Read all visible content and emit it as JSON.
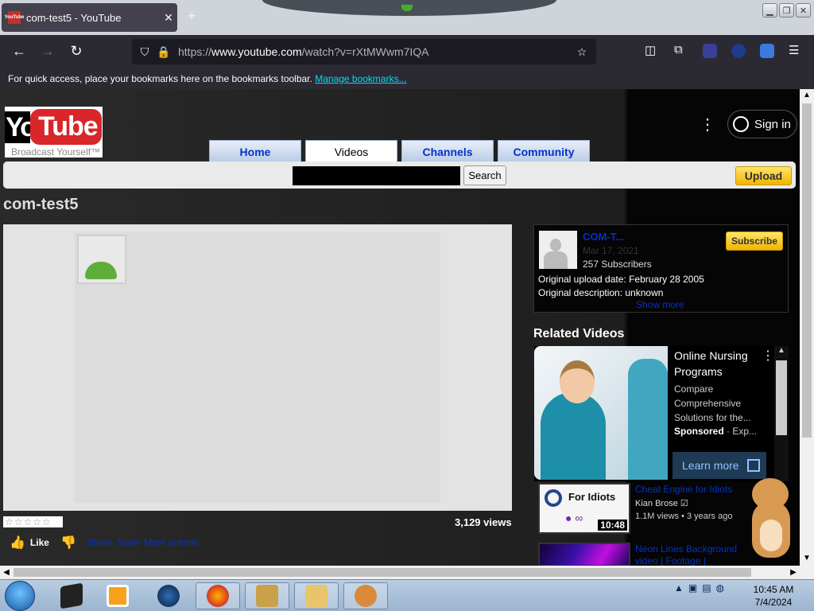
{
  "browser": {
    "tab_title": "com-test5 - YouTube",
    "tab_favicon": "YouTube",
    "tab_close": "✕",
    "new_tab": "+",
    "url_prefix": "https://",
    "url_host": "www.youtube.com",
    "url_path": "/watch?v=rXtMWwm7IQA",
    "bookmarks_text": "For quick access, place your bookmarks here on the bookmarks toolbar.",
    "bookmarks_link": "Manage bookmarks..."
  },
  "header": {
    "logo_you": "You",
    "logo_tube": "Tube",
    "logo_tagline": "Broadcast Yourself™",
    "signin": "Sign in",
    "nav_tabs": [
      "Home",
      "Videos",
      "Channels",
      "Community"
    ],
    "search_button": "Search",
    "upload_button": "Upload"
  },
  "video": {
    "title": "com-test5",
    "stars": "☆☆☆☆☆",
    "views": "3,129 views",
    "like": "Like",
    "share": "Share",
    "save": "Save",
    "more_actions": "More actions"
  },
  "channel": {
    "name": "COM-T...",
    "date": "Mar 17, 2021",
    "subscribers": "257 Subscribers",
    "subscribe_button": "Subscribe",
    "upload_date": "Original upload date: February 28 2005",
    "description": "Original description: unknown",
    "show_more": "Show more"
  },
  "related": {
    "heading": "Related Videos",
    "ad": {
      "title": "Online Nursing Programs",
      "description": "Compare Comprehensive Solutions for the...",
      "sponsored": "Sponsored",
      "sponsor_suffix": " · Exp...",
      "cta": "Learn more"
    },
    "items": [
      {
        "thumb_text": "For Idiots",
        "duration": "10:48",
        "title": "Cheat Engine for Idiots",
        "author": "Kian Brose",
        "meta": "1.1M views • 3 years ago"
      },
      {
        "title": "Neon Lines Background video | Footage |"
      }
    ]
  },
  "taskbar": {
    "time": "10:45 AM",
    "date": "7/4/2024"
  },
  "colors": {
    "link_blue": "#0033cc",
    "upload_yellow": "#f1b400",
    "youtube_red": "#d8262a"
  }
}
